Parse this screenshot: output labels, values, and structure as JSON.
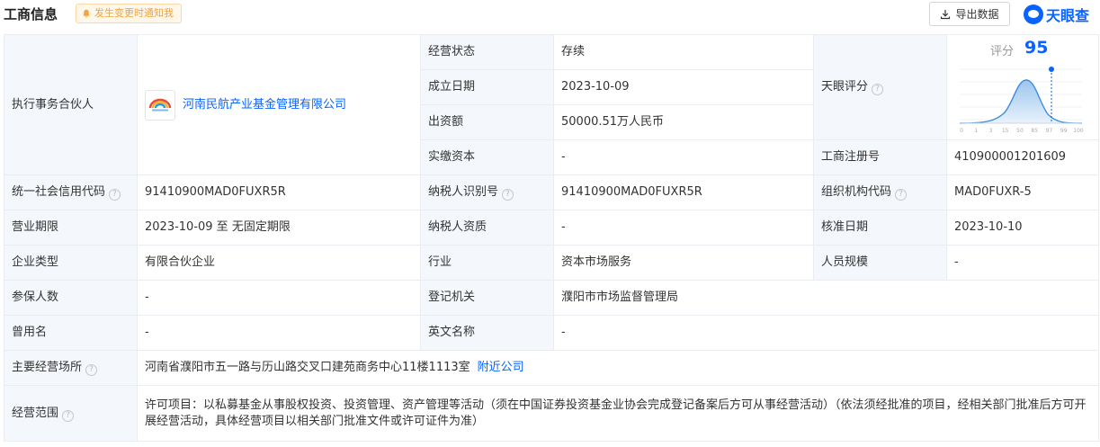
{
  "header": {
    "title": "工商信息",
    "notify_label": "发生变更时通知我",
    "export_label": "导出数据",
    "brand": "天眼查"
  },
  "partner": {
    "label": "执行事务合伙人",
    "company_name": "河南民航产业基金管理有限公司"
  },
  "status": {
    "label": "经营状态",
    "value": "存续"
  },
  "established": {
    "label": "成立日期",
    "value": "2023-10-09"
  },
  "capital": {
    "label": "出资额",
    "value": "50000.51万人民币"
  },
  "paid_capital": {
    "label": "实缴资本",
    "value": "-"
  },
  "tianyan_score": {
    "label": "天眼评分",
    "score_label": "评分",
    "score": "95",
    "axis_ticks": [
      "0",
      "1",
      "3",
      "15",
      "50",
      "85",
      "97",
      "99",
      "100"
    ]
  },
  "reg_number": {
    "label": "工商注册号",
    "value": "410900001201609"
  },
  "credit_code": {
    "label": "统一社会信用代码",
    "value": "91410900MAD0FUXR5R"
  },
  "taxpayer_id": {
    "label": "纳税人识别号",
    "value": "91410900MAD0FUXR5R"
  },
  "org_code": {
    "label": "组织机构代码",
    "value": "MAD0FUXR-5"
  },
  "business_term": {
    "label": "营业期限",
    "value": "2023-10-09 至 无固定期限"
  },
  "taxpayer_qual": {
    "label": "纳税人资质",
    "value": "-"
  },
  "approval_date": {
    "label": "核准日期",
    "value": "2023-10-10"
  },
  "enterprise_type": {
    "label": "企业类型",
    "value": "有限合伙企业"
  },
  "industry": {
    "label": "行业",
    "value": "资本市场服务"
  },
  "staff_size": {
    "label": "人员规模",
    "value": "-"
  },
  "insured": {
    "label": "参保人数",
    "value": "-"
  },
  "registration_authority": {
    "label": "登记机关",
    "value": "濮阳市市场监督管理局"
  },
  "former_name": {
    "label": "曾用名",
    "value": "-"
  },
  "english_name": {
    "label": "英文名称",
    "value": "-"
  },
  "address": {
    "label": "主要经营场所",
    "value": "河南省濮阳市五一路与历山路交叉口建苑商务中心11楼1113室",
    "nearby_link": "附近公司"
  },
  "scope": {
    "label": "经营范围",
    "value": "许可项目：以私募基金从事股权投资、投资管理、资产管理等活动（须在中国证券投资基金业协会完成登记备案后方可从事经营活动）（依法须经批准的项目，经相关部门批准后方可开展经营活动，具体经营项目以相关部门批准文件或许可证件为准）"
  },
  "colors": {
    "accent": "#0a63ff",
    "label_bg": "#f4f7fb",
    "border": "#e9ecf1",
    "notify": "#f5a33a"
  }
}
